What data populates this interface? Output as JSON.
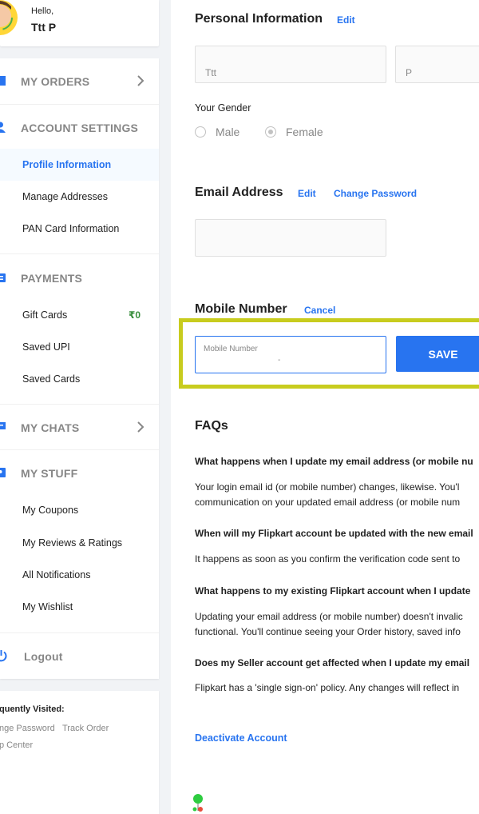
{
  "greeting": {
    "hello": "Hello,",
    "name": "Ttt P"
  },
  "sidebar": {
    "my_orders": "MY ORDERS",
    "account_settings": "ACCOUNT SETTINGS",
    "account_items": [
      "Profile Information",
      "Manage Addresses",
      "PAN Card Information"
    ],
    "payments": "PAYMENTS",
    "payment_items": [
      "Gift Cards",
      "Saved UPI",
      "Saved Cards"
    ],
    "gift_card_balance": "₹0",
    "my_chats": "MY CHATS",
    "my_stuff": "MY STUFF",
    "stuff_items": [
      "My Coupons",
      "My Reviews & Ratings",
      "All Notifications",
      "My Wishlist"
    ],
    "logout": "Logout"
  },
  "frequently": {
    "title": "quently Visited:",
    "links": [
      "nge Password",
      "Track Order",
      "p Center"
    ]
  },
  "personal": {
    "title": "Personal Information",
    "edit": "Edit",
    "first_name": "Ttt",
    "last_name": "P",
    "gender_label": "Your Gender",
    "male": "Male",
    "female": "Female",
    "selected_gender": "Female"
  },
  "email": {
    "title": "Email Address",
    "edit": "Edit",
    "change_password": "Change Password",
    "value": ""
  },
  "mobile": {
    "title": "Mobile Number",
    "cancel": "Cancel",
    "placeholder": "Mobile Number",
    "value": "-",
    "save": "SAVE"
  },
  "faqs": {
    "title": "FAQs",
    "q1": "What happens when I update my email address (or mobile nu",
    "a1_line1": "Your login email id (or mobile number) changes, likewise. You'l",
    "a1_line2": "communication on your updated email address (or mobile num",
    "q2": "When will my Flipkart account be updated with the new email",
    "a2": "It happens as soon as you confirm the verification code sent to",
    "q3": "What happens to my existing Flipkart account when I update",
    "a3_line1": "Updating your email address (or mobile number) doesn't invalic",
    "a3_line2": "functional. You'll continue seeing your Order history, saved info",
    "q4": "Does my Seller account get affected when I update my email",
    "a4": "Flipkart has a 'single sign-on' policy. Any changes will reflect in"
  },
  "deactivate": "Deactivate Account",
  "colors": {
    "accent": "#2874f0",
    "highlight": "#c8cc1e",
    "green": "#388e3c"
  },
  "icons": [
    "orders-icon",
    "user-icon",
    "wallet-icon",
    "chat-icon",
    "stuff-icon",
    "power-icon",
    "chevron-right-icon"
  ]
}
